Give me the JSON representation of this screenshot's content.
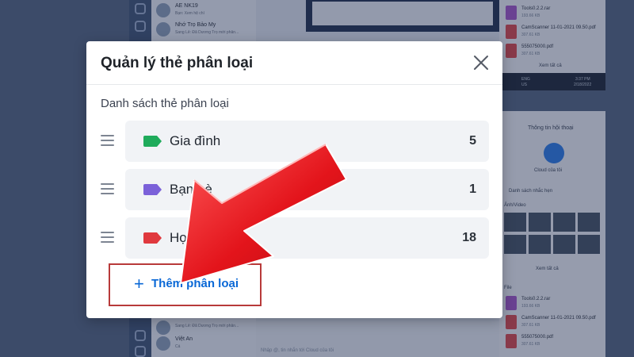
{
  "modal": {
    "title": "Quản lý thẻ phân loại",
    "section_label": "Danh sách thẻ phân loại",
    "tags": [
      {
        "name": "Gia đình",
        "count": "5",
        "color": "#1fab5b"
      },
      {
        "name": "Bạn bè",
        "count": "1",
        "color": "#7b61d9"
      },
      {
        "name": "Học Tập",
        "count": "18",
        "color": "#e0393e"
      }
    ],
    "add_button": {
      "icon": "+",
      "label": "Thêm phân loại"
    }
  },
  "background": {
    "chats": [
      {
        "name": "AE NK19",
        "preview": "Bạn: Xem hệ chí"
      },
      {
        "name": "Nhớ Trọ Bảo My",
        "preview": "Sang Lê: Đã Dương Trọ mới phân..."
      },
      {
        "name": "",
        "preview": "Sang Lê: Đã Dương Trọ mới phân..."
      },
      {
        "name": "Việt An",
        "preview": "Cá"
      }
    ],
    "files_top": [
      {
        "name": "Tools0.2.2.rar",
        "size": "193.66 KB"
      },
      {
        "name": "CamScanner 11-01-2021 09.50.pdf",
        "size": "307.61 KB"
      },
      {
        "name": "555075000.pdf",
        "size": "307.61 KB"
      }
    ],
    "files_bottom": [
      {
        "name": "Tools0.2.2.rar",
        "size": "193.66 KB"
      },
      {
        "name": "CamScanner 11-01-2021 09.50.pdf",
        "size": "307.61 KB"
      },
      {
        "name": "555075000.pdf",
        "size": "307.61 KB"
      }
    ],
    "see_all_top": "Xem tất cả",
    "taskbar_lang": "ENG",
    "taskbar_region": "US",
    "taskbar_time": "3:37 PM",
    "taskbar_date": "2/18/2022",
    "conv_info_title": "Thông tin hội thoại",
    "cloud_label": "Cloud của tôi",
    "reminder_label": "Danh sách nhắc hẹn",
    "media_label": "Ảnh/Video",
    "see_all_media": "Xem tất cả",
    "files_label": "File",
    "input_hint": "Nhập @, tin nhắn tới Cloud của tôi"
  },
  "colors": {
    "accent": "#0a68d6",
    "highlight_border": "#b83a3a",
    "arrow": "#e3141b"
  }
}
